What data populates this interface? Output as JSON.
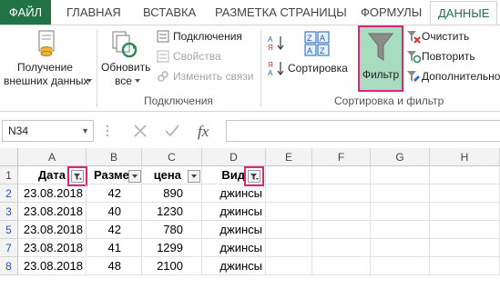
{
  "tabs": {
    "file": "ФАЙЛ",
    "items": [
      "ГЛАВНАЯ",
      "ВСТАВКА",
      "РАЗМЕТКА СТРАНИЦЫ",
      "ФОРМУЛЫ",
      "ДАННЫЕ"
    ],
    "active": "ДАННЫЕ"
  },
  "ribbon": {
    "get_external_line1": "Получение",
    "get_external_line2": "внешних данных",
    "refresh_all_line1": "Обновить",
    "refresh_all_line2": "все",
    "connections": "Подключения",
    "properties": "Свойства",
    "edit_links": "Изменить связи",
    "group_connections": "Подключения",
    "sort": "Сортировка",
    "filter": "Фильтр",
    "clear": "Очистить",
    "reapply": "Повторить",
    "advanced": "Дополнительно",
    "group_sort_filter": "Сортировка и фильтр"
  },
  "formula_bar": {
    "name_box": "N34",
    "formula": ""
  },
  "grid": {
    "columns": [
      "A",
      "B",
      "C",
      "D",
      "E",
      "F",
      "G",
      "H"
    ],
    "rows": [
      "1",
      "2",
      "3",
      "5",
      "7",
      "8"
    ],
    "header_cells": [
      "Дата",
      "Разме",
      "цена",
      "Вид"
    ],
    "data": [
      [
        "23.08.2018",
        "42",
        "890",
        "джинсы"
      ],
      [
        "23.08.2018",
        "40",
        "1230",
        "джинсы"
      ],
      [
        "23.08.2018",
        "42",
        "780",
        "джинсы"
      ],
      [
        "23.08.2018",
        "41",
        "1299",
        "джинсы"
      ],
      [
        "23.08.2018",
        "48",
        "2100",
        "джинсы"
      ]
    ]
  },
  "colors": {
    "excel_green": "#217346",
    "filter_active_bg": "#a8dcbe",
    "highlight": "#e0247c",
    "filtered_row_number": "#1f4fd8"
  }
}
